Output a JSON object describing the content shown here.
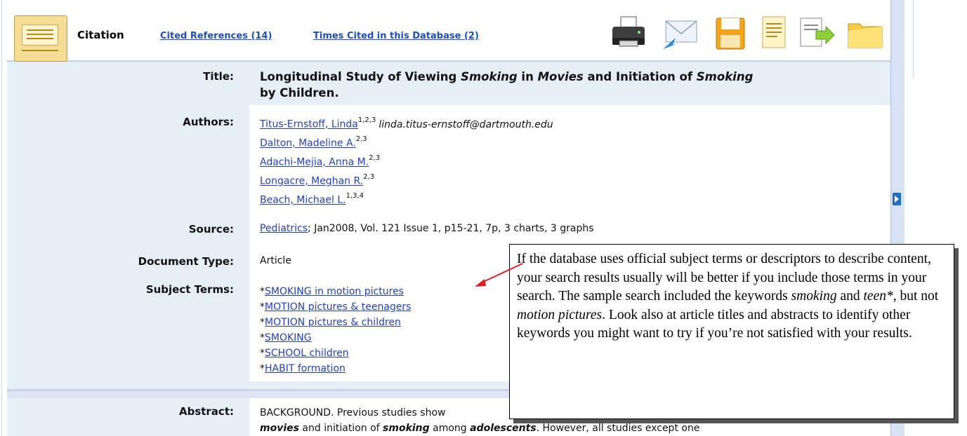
{
  "toolbar": {
    "citation_label": "Citation",
    "cited_refs_label": "Cited References",
    "cited_refs_count": "(14)",
    "times_cited_label": "Times Cited in this Database",
    "times_cited_count": "(2)",
    "icons": [
      "print-icon",
      "email-icon",
      "save-icon",
      "cite-icon",
      "export-icon",
      "folder-icon"
    ]
  },
  "record": {
    "labels": {
      "title": "Title:",
      "authors": "Authors:",
      "source": "Source:",
      "document_type": "Document Type:",
      "subject_terms": "Subject Terms:",
      "abstract": "Abstract:"
    },
    "title": {
      "part1": "Longitudinal Study of Viewing ",
      "em1": "Smoking",
      "part2": " in ",
      "em2": "Movies",
      "part3": " and Initiation of ",
      "em3": "Smoking",
      "line2": "by Children."
    },
    "authors": [
      {
        "name": "Titus-Ernstoff, Linda",
        "sup": "1,2,3",
        "email": "linda.titus-ernstoff@dartmouth.edu"
      },
      {
        "name": "Dalton, Madeline A.",
        "sup": "2,3"
      },
      {
        "name": "Adachi-Mejia, Anna M.",
        "sup": "2,3"
      },
      {
        "name": "Longacre, Meghan R.",
        "sup": "2,3"
      },
      {
        "name": "Beach, Michael L.",
        "sup": "1,3,4"
      }
    ],
    "source": {
      "journal": "Pediatrics",
      "details": "; Jan2008, Vol. 121 Issue 1, p15-21, 7p, 3 charts, 3 graphs"
    },
    "document_type": "Article",
    "subject_terms": [
      "SMOKING in motion pictures",
      "MOTION pictures & teenagers",
      "MOTION pictures & children",
      "SMOKING",
      "SCHOOL children",
      "HABIT formation"
    ],
    "subject_prefix": "*",
    "abstract": {
      "line1": "BACKGROUND. Previous studies show",
      "line2a": "movies",
      "line2b": " and initiation of ",
      "line2c": "smoking",
      "line2d": " among ",
      "line2e": "adolescents",
      "line2f": ". However, all studies except one"
    }
  },
  "callout": {
    "p1": "If the database uses official subject terms or descriptors to describe content, your search results usually will be better if you include those terms in your search. The sample search included the keywords ",
    "kw1": "smoking",
    "p2": " and ",
    "kw2": "teen*",
    "p3": ", but not ",
    "kw3": "motion pictures",
    "p4": ". Look also at article titles and abstracts to identify other keywords you might want to try if you’re not satisfied with your results."
  },
  "colors": {
    "link": "#1f3fc4",
    "panel": "#e6eef8",
    "arrow": "#e02020",
    "toggle": "#1e6fc6"
  }
}
